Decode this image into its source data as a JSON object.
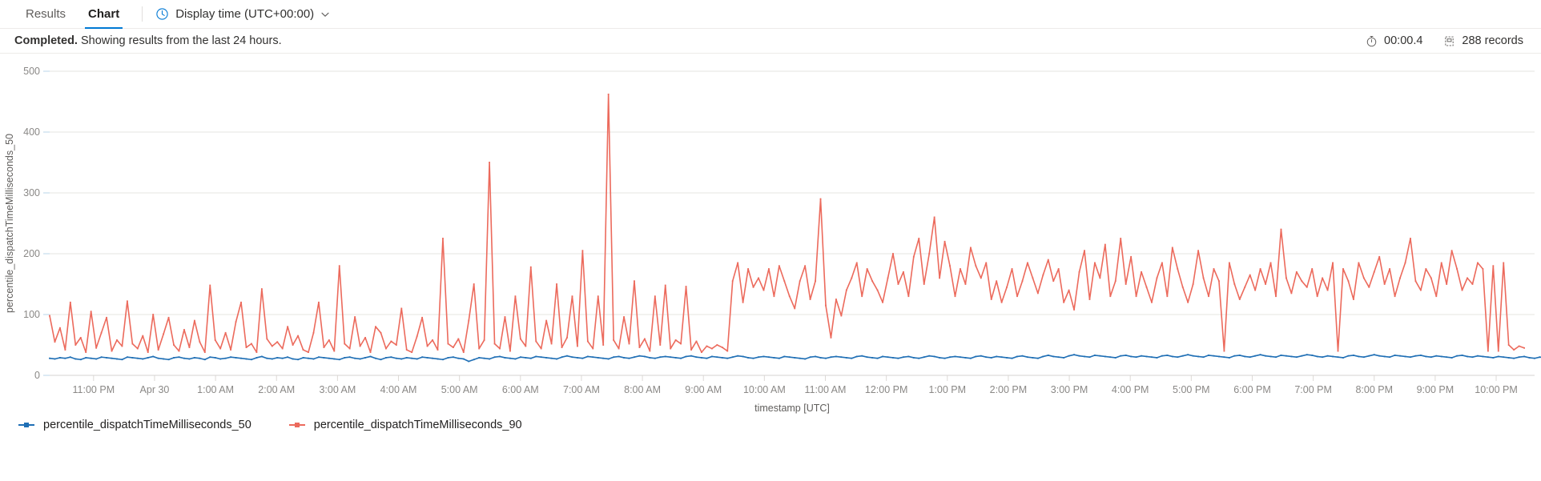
{
  "tabs": [
    {
      "label": "Results",
      "active": false,
      "name": "tab-results"
    },
    {
      "label": "Chart",
      "active": true,
      "name": "tab-chart"
    }
  ],
  "timezone_control": {
    "icon": "clock-icon",
    "label": "Display time (UTC+00:00)",
    "chevron": "chevron-down-icon"
  },
  "status": {
    "state": "Completed.",
    "detail": "Showing results from the last 24 hours.",
    "duration_icon": "stopwatch-icon",
    "duration": "00:00.4",
    "records_icon": "records-icon",
    "records": "288 records"
  },
  "colors": {
    "accent": "#0078d4",
    "series_50": "#1f6fb5",
    "series_90": "#ec6a5c",
    "gridline": "#e6e4e2",
    "tick_text": "#8a8886"
  },
  "chart_data": {
    "type": "line",
    "title": "",
    "xlabel": "timestamp [UTC]",
    "ylabel": "percentile_dispatchTimeMilliseconds_50",
    "ylim": [
      0,
      500
    ],
    "yticks": [
      0,
      100,
      200,
      300,
      400,
      500
    ],
    "grid": true,
    "legend_position": "bottom-left",
    "x_tick_labels": [
      "11:00 PM",
      "Apr 30",
      "1:00 AM",
      "2:00 AM",
      "3:00 AM",
      "4:00 AM",
      "5:00 AM",
      "6:00 AM",
      "7:00 AM",
      "8:00 AM",
      "9:00 AM",
      "10:00 AM",
      "11:00 AM",
      "12:00 PM",
      "1:00 PM",
      "2:00 PM",
      "3:00 PM",
      "4:00 PM",
      "5:00 PM",
      "6:00 PM",
      "7:00 PM",
      "8:00 PM",
      "9:00 PM",
      "10:00 PM"
    ],
    "x_count": 288,
    "series": [
      {
        "name": "percentile_dispatchTimeMilliseconds_50",
        "color": "#1f6fb5",
        "values": [
          28,
          27,
          29,
          28,
          30,
          27,
          26,
          29,
          28,
          27,
          30,
          29,
          28,
          27,
          26,
          30,
          29,
          28,
          27,
          29,
          31,
          28,
          27,
          26,
          29,
          30,
          28,
          27,
          29,
          28,
          26,
          30,
          29,
          27,
          28,
          30,
          29,
          28,
          27,
          26,
          29,
          31,
          28,
          27,
          29,
          28,
          30,
          27,
          26,
          29,
          28,
          27,
          30,
          29,
          28,
          27,
          26,
          29,
          30,
          28,
          27,
          29,
          31,
          28,
          26,
          29,
          30,
          28,
          27,
          29,
          28,
          27,
          30,
          29,
          28,
          27,
          26,
          29,
          30,
          28,
          27,
          23,
          26,
          29,
          28,
          27,
          30,
          31,
          29,
          28,
          27,
          30,
          29,
          28,
          31,
          30,
          29,
          28,
          27,
          30,
          32,
          30,
          29,
          28,
          31,
          30,
          29,
          28,
          27,
          30,
          31,
          29,
          28,
          30,
          32,
          31,
          29,
          28,
          30,
          31,
          30,
          29,
          28,
          31,
          32,
          30,
          29,
          28,
          31,
          30,
          29,
          28,
          30,
          32,
          31,
          29,
          28,
          30,
          31,
          30,
          29,
          28,
          31,
          30,
          29,
          28,
          27,
          30,
          31,
          29,
          28,
          30,
          31,
          30,
          29,
          28,
          31,
          32,
          30,
          29,
          28,
          31,
          30,
          29,
          28,
          30,
          31,
          29,
          28,
          30,
          32,
          31,
          29,
          28,
          30,
          31,
          30,
          29,
          28,
          31,
          32,
          30,
          29,
          31,
          30,
          29,
          28,
          31,
          32,
          30,
          29,
          28,
          31,
          33,
          31,
          30,
          29,
          32,
          34,
          32,
          31,
          30,
          33,
          32,
          31,
          30,
          29,
          32,
          33,
          31,
          30,
          32,
          31,
          30,
          29,
          32,
          33,
          31,
          30,
          32,
          34,
          32,
          31,
          30,
          33,
          32,
          31,
          30,
          29,
          32,
          33,
          31,
          30,
          32,
          34,
          32,
          31,
          30,
          33,
          32,
          31,
          30,
          32,
          34,
          33,
          31,
          30,
          32,
          31,
          30,
          29,
          32,
          33,
          31,
          30,
          32,
          34,
          32,
          31,
          30,
          33,
          32,
          31,
          30,
          32,
          33,
          31,
          30,
          32,
          31,
          30,
          29,
          32,
          33,
          31,
          30,
          32,
          31,
          30,
          29,
          31,
          30,
          29,
          28,
          30,
          31,
          29,
          28,
          30,
          29,
          28
        ]
      },
      {
        "name": "percentile_dispatchTimeMilliseconds_90",
        "color": "#ec6a5c",
        "values": [
          98,
          55,
          78,
          42,
          120,
          50,
          62,
          38,
          105,
          45,
          70,
          95,
          40,
          58,
          48,
          122,
          52,
          44,
          65,
          38,
          100,
          42,
          68,
          95,
          50,
          40,
          75,
          46,
          90,
          55,
          38,
          148,
          58,
          44,
          70,
          42,
          88,
          120,
          46,
          52,
          38,
          142,
          60,
          48,
          55,
          44,
          80,
          50,
          65,
          42,
          38,
          70,
          120,
          46,
          58,
          40,
          180,
          52,
          44,
          96,
          48,
          62,
          38,
          80,
          70,
          44,
          56,
          50,
          110,
          42,
          38,
          64,
          95,
          48,
          58,
          42,
          225,
          52,
          46,
          60,
          38,
          90,
          150,
          44,
          58,
          350,
          52,
          44,
          96,
          40,
          130,
          60,
          48,
          178,
          56,
          44,
          90,
          52,
          150,
          46,
          62,
          130,
          48,
          205,
          56,
          44,
          130,
          50,
          462,
          58,
          44,
          96,
          52,
          155,
          46,
          60,
          40,
          130,
          50,
          148,
          44,
          58,
          52,
          146,
          42,
          56,
          38,
          48,
          44,
          50,
          46,
          40,
          155,
          185,
          120,
          175,
          145,
          160,
          140,
          175,
          130,
          180,
          155,
          130,
          110,
          155,
          180,
          125,
          155,
          290,
          115,
          62,
          125,
          98,
          140,
          160,
          185,
          130,
          175,
          155,
          140,
          120,
          160,
          200,
          150,
          170,
          130,
          195,
          225,
          150,
          200,
          260,
          160,
          220,
          180,
          130,
          175,
          150,
          210,
          180,
          160,
          185,
          125,
          155,
          120,
          145,
          175,
          130,
          155,
          185,
          160,
          135,
          165,
          190,
          155,
          175,
          120,
          140,
          108,
          170,
          205,
          125,
          185,
          160,
          215,
          130,
          155,
          225,
          150,
          195,
          130,
          170,
          145,
          120,
          160,
          185,
          130,
          210,
          175,
          145,
          120,
          150,
          205,
          160,
          130,
          175,
          155,
          40,
          185,
          150,
          125,
          145,
          165,
          140,
          175,
          150,
          185,
          130,
          240,
          160,
          135,
          170,
          155,
          145,
          175,
          130,
          160,
          140,
          185,
          40,
          175,
          155,
          125,
          185,
          160,
          145,
          170,
          195,
          150,
          175,
          130,
          160,
          185,
          225,
          155,
          140,
          175,
          160,
          130,
          185,
          150,
          205,
          175,
          140,
          160,
          150,
          185,
          175,
          40,
          180,
          40,
          185,
          50,
          42,
          48,
          45
        ]
      }
    ]
  }
}
